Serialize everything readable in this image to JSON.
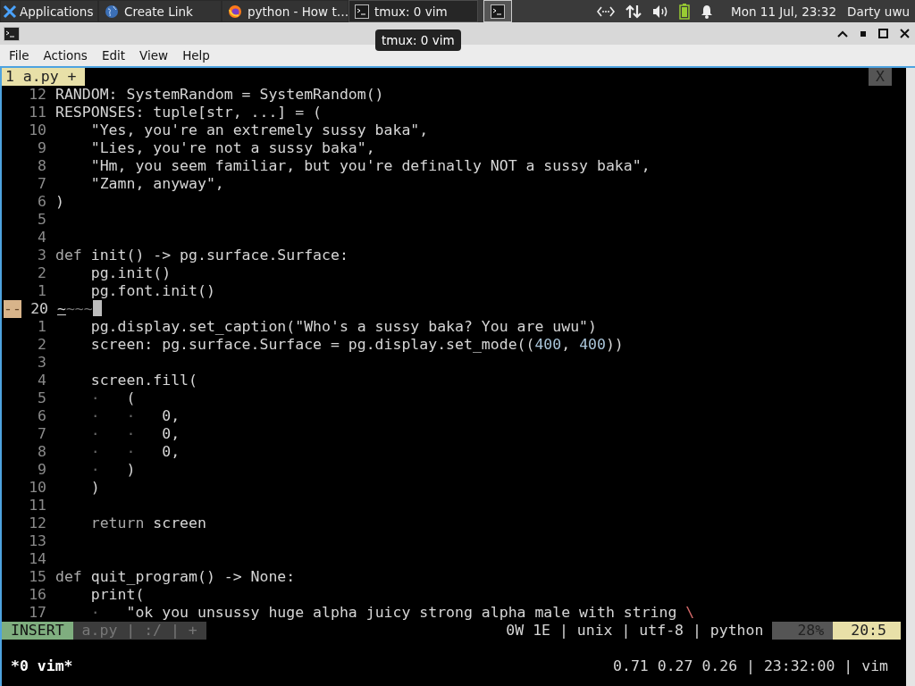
{
  "taskbar": {
    "tasks": [
      {
        "kind": "apps",
        "label": "Applications",
        "selected": false
      },
      {
        "kind": "globe",
        "label": "Create Link",
        "selected": false
      },
      {
        "kind": "firefox",
        "label": "python - How t…",
        "selected": false
      },
      {
        "kind": "terminal",
        "label": "tmux: 0 vim",
        "selected": true
      },
      {
        "kind": "terminal-only",
        "selected": true
      }
    ],
    "clock": "Mon 11 Jul, 23:32",
    "user": "Darty uwu"
  },
  "tooltip": "tmux: 0 vim",
  "menu": [
    "File",
    "Actions",
    "Edit",
    "View",
    "Help"
  ],
  "vim": {
    "tab": "1 a.py +",
    "close": "X",
    "lines": [
      {
        "num": "12",
        "code": [
          {
            "kind": "plain",
            "text": "RANDOM: SystemRandom = SystemRandom()"
          }
        ]
      },
      {
        "num": "11",
        "code": [
          {
            "kind": "plain",
            "text": "RESPONSES: tuple[str, ...] = ("
          }
        ]
      },
      {
        "num": "10",
        "code": [
          {
            "kind": "plain",
            "text": "    \"Yes, you're an extremely sussy baka\","
          }
        ]
      },
      {
        "num": "9",
        "code": [
          {
            "kind": "plain",
            "text": "    \"Lies, you're not a sussy baka\","
          }
        ]
      },
      {
        "num": "8",
        "code": [
          {
            "kind": "plain",
            "text": "    \"Hm, you seem familiar, but you're definally NOT a sussy baka\","
          }
        ]
      },
      {
        "num": "7",
        "code": [
          {
            "kind": "plain",
            "text": "    \"Zamn, anyway\","
          }
        ]
      },
      {
        "num": "6",
        "code": [
          {
            "kind": "plain",
            "text": ")"
          }
        ]
      },
      {
        "num": "5"
      },
      {
        "num": "4"
      },
      {
        "num": "3",
        "code": [
          {
            "kind": "keyword",
            "text": "def"
          },
          {
            "kind": "plain",
            "text": " init() -> pg.surface.Surface:"
          }
        ]
      },
      {
        "num": "2",
        "code": [
          {
            "kind": "plain",
            "text": "    pg.init()"
          }
        ]
      },
      {
        "num": "1",
        "code": [
          {
            "kind": "plain",
            "text": "    pg.font.init()"
          }
        ]
      },
      {
        "num": "20",
        "current": true,
        "marker": "--",
        "code": [
          {
            "kind": "under",
            "text": "~"
          },
          {
            "kind": "dim",
            "text": "~~~"
          }
        ]
      },
      {
        "num": "1",
        "code": [
          {
            "kind": "plain",
            "text": "    pg.display.set_caption(\"Who's a sussy baka? You are uwu\")"
          }
        ]
      },
      {
        "num": "2",
        "code": [
          {
            "kind": "plain",
            "text": "    screen: pg.surface.Surface = pg.display.set_mode(("
          },
          {
            "kind": "number",
            "text": "400"
          },
          {
            "kind": "plain",
            "text": ", "
          },
          {
            "kind": "number",
            "text": "400"
          },
          {
            "kind": "plain",
            "text": "))"
          }
        ]
      },
      {
        "num": "3"
      },
      {
        "num": "4",
        "code": [
          {
            "kind": "plain",
            "text": "    screen.fill("
          }
        ]
      },
      {
        "num": "5",
        "code": [
          {
            "kind": "guide",
            "text": "    ·   "
          },
          {
            "kind": "plain",
            "text": "("
          }
        ]
      },
      {
        "num": "6",
        "code": [
          {
            "kind": "guide",
            "text": "    ·   ·   "
          },
          {
            "kind": "plain",
            "text": "0,"
          }
        ]
      },
      {
        "num": "7",
        "code": [
          {
            "kind": "guide",
            "text": "    ·   ·   "
          },
          {
            "kind": "plain",
            "text": "0,"
          }
        ]
      },
      {
        "num": "8",
        "code": [
          {
            "kind": "guide",
            "text": "    ·   ·   "
          },
          {
            "kind": "plain",
            "text": "0,"
          }
        ]
      },
      {
        "num": "9",
        "code": [
          {
            "kind": "guide",
            "text": "    ·   "
          },
          {
            "kind": "plain",
            "text": ")"
          }
        ]
      },
      {
        "num": "10",
        "code": [
          {
            "kind": "plain",
            "text": "    )"
          }
        ]
      },
      {
        "num": "11"
      },
      {
        "num": "12",
        "code": [
          {
            "kind": "keyword",
            "text": "    return"
          },
          {
            "kind": "plain",
            "text": " screen"
          }
        ]
      },
      {
        "num": "13"
      },
      {
        "num": "14"
      },
      {
        "num": "15",
        "code": [
          {
            "kind": "keyword",
            "text": "def"
          },
          {
            "kind": "plain",
            "text": " quit_program() -> None:"
          }
        ]
      },
      {
        "num": "16",
        "code": [
          {
            "kind": "plain",
            "text": "    print("
          }
        ]
      },
      {
        "num": "17",
        "code": [
          {
            "kind": "guide",
            "text": "    ·   "
          },
          {
            "kind": "plain",
            "text": "\"ok you unsussy huge alpha juicy strong alpha male with string "
          },
          {
            "kind": "escape",
            "text": "\\"
          }
        ]
      }
    ],
    "statusline": {
      "mode": "INSERT",
      "file_info": "a.py | :/ | +",
      "info": "0W 1E | unix | utf-8 | python",
      "percent": "28%",
      "position": "20:5"
    }
  },
  "tmux": {
    "session": "*0 vim*",
    "status": "0.71 0.27 0.26 | 23:32:00 | vim"
  }
}
